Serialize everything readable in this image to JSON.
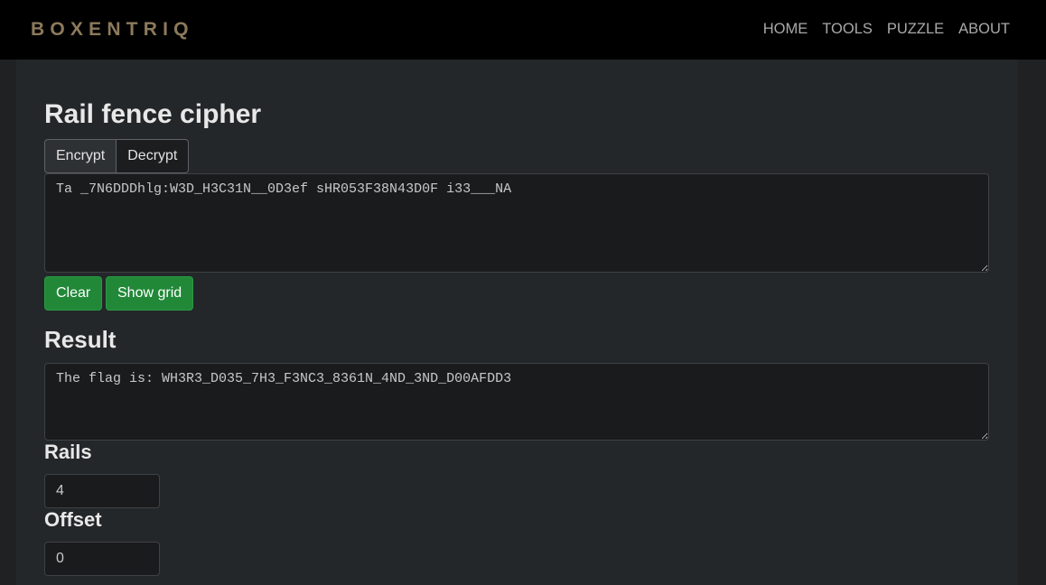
{
  "brand": {
    "logo": "BOXENTRIQ"
  },
  "nav": {
    "items": [
      {
        "label": "HOME"
      },
      {
        "label": "TOOLS"
      },
      {
        "label": "PUZZLE"
      },
      {
        "label": "ABOUT"
      }
    ]
  },
  "page": {
    "title": "Rail fence cipher",
    "mode": {
      "encrypt_label": "Encrypt",
      "decrypt_label": "Decrypt",
      "selected": "Encrypt"
    },
    "input_text": "Ta _7N6DDDhlg:W3D_H3C31N__0D3ef sHR053F38N43D0F i33___NA",
    "buttons": {
      "clear_label": "Clear",
      "show_grid_label": "Show grid"
    },
    "result": {
      "heading": "Result",
      "text": "The flag is: WH3R3_D035_7H3_F3NC3_8361N_4ND_3ND_D00AFDD3"
    },
    "rails": {
      "label": "Rails",
      "value": "4"
    },
    "offset": {
      "label": "Offset",
      "value": "0"
    }
  },
  "colors": {
    "navbar_bg": "#000000",
    "logo": "#8c7a5c",
    "page_bg": "#1f2123",
    "content_bg": "#242729",
    "button_green": "#218838"
  }
}
